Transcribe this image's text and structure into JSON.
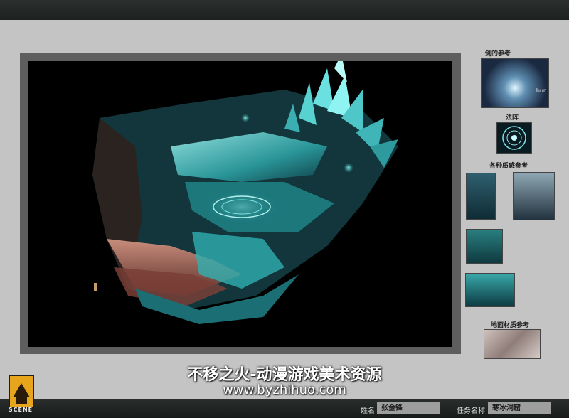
{
  "refs": {
    "sword_label": "剑的参考",
    "circle_label": "法阵",
    "materials_label": "各种质感参考",
    "ground_label": "地面材质参考",
    "thumb_text": "bur."
  },
  "watermark": {
    "line1": "不移之火-动漫游戏美术资源",
    "line2": "www.byzhihuo.com"
  },
  "footer": {
    "logo_text": "SCENE",
    "name_label": "姓名",
    "name_value": "张金锋",
    "task_label": "任务名称",
    "task_value": "寒冰洞窟"
  },
  "colors": {
    "ice": "#3fc9c4",
    "ice_dark": "#0f4d52",
    "rock": "#9a5a4e",
    "logo": "#e6a51b"
  }
}
